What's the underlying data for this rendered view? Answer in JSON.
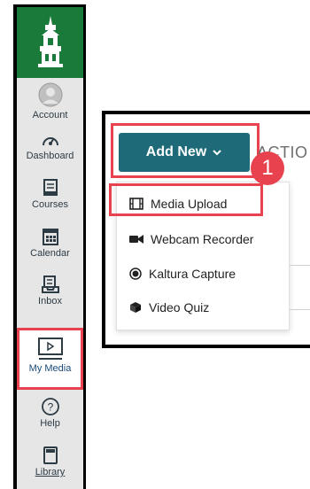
{
  "sidebar": {
    "items": [
      {
        "label": "Account",
        "icon": "account-icon"
      },
      {
        "label": "Dashboard",
        "icon": "dashboard-icon"
      },
      {
        "label": "Courses",
        "icon": "courses-icon"
      },
      {
        "label": "Calendar",
        "icon": "calendar-icon"
      },
      {
        "label": "Inbox",
        "icon": "inbox-icon"
      },
      {
        "label": "My Media",
        "icon": "my-media-icon"
      },
      {
        "label": "Help",
        "icon": "help-icon"
      },
      {
        "label": "Library",
        "icon": "library-icon"
      }
    ],
    "colors": {
      "brand": "#1a7a3a",
      "highlight": "#e8424f"
    }
  },
  "toolbar": {
    "add_new_label": "Add New",
    "actions_label": "ACTIO",
    "step_badge": "1",
    "button_color": "#1e6a78"
  },
  "dropdown": {
    "items": [
      {
        "label": "Media Upload",
        "icon": "film-icon"
      },
      {
        "label": "Webcam Recorder",
        "icon": "video-camera-icon"
      },
      {
        "label": "Kaltura Capture",
        "icon": "record-icon"
      },
      {
        "label": "Video Quiz",
        "icon": "cube-icon"
      }
    ]
  }
}
